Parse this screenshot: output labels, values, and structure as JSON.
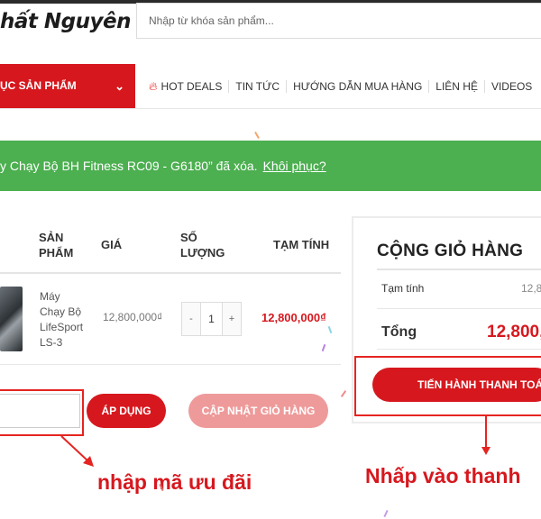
{
  "header": {
    "logo_text": "hất Nguyên",
    "search_placeholder": "Nhập từ khóa sản phẩm..."
  },
  "nav": {
    "category_label": "ỤC SẢN PHẨM",
    "category_chevron": "⌄",
    "links": [
      "HOT DEALS",
      "TIN TỨC",
      "HƯỚNG DẪN MUA HÀNG",
      "LIÊN HỆ",
      "VIDEOS"
    ]
  },
  "notice": {
    "message": "y Chạy Bộ BH Fitness RC09 - G6180” đã xóa.",
    "undo_label": "Khôi phục?"
  },
  "table": {
    "col_product_1": "SẢN",
    "col_product_2": "PHẨM",
    "col_price": "GIÁ",
    "col_qty_1": "SỐ",
    "col_qty_2": "LƯỢNG",
    "col_subtotal": "TẠM TÍNH",
    "row": {
      "name_lines": [
        "Máy",
        "Chạy Bộ",
        "LifeSport",
        "LS-3"
      ],
      "price": "12,800,000₫",
      "qty_minus": "-",
      "qty": "1",
      "qty_plus": "+",
      "subtotal": "12,800,000₫"
    }
  },
  "coupon": {
    "apply_label": "ÁP DỤNG",
    "update_label": "CẬP NHẬT GIỎ HÀNG"
  },
  "cart_totals": {
    "title": "CỘNG GIỎ HÀNG",
    "subtotal_label": "Tạm tính",
    "subtotal_value": "12,8",
    "total_label": "Tổng",
    "total_value": "12,800,",
    "checkout_label": "TIẾN HÀNH THANH TOÁN"
  },
  "annotations": {
    "coupon_hint": "nhập mã ưu đãi",
    "checkout_hint": "Nhấp vào thanh"
  },
  "colors": {
    "brand_red": "#d6181e",
    "notice_green": "#4caf50",
    "annotation_red": "#e52421"
  }
}
